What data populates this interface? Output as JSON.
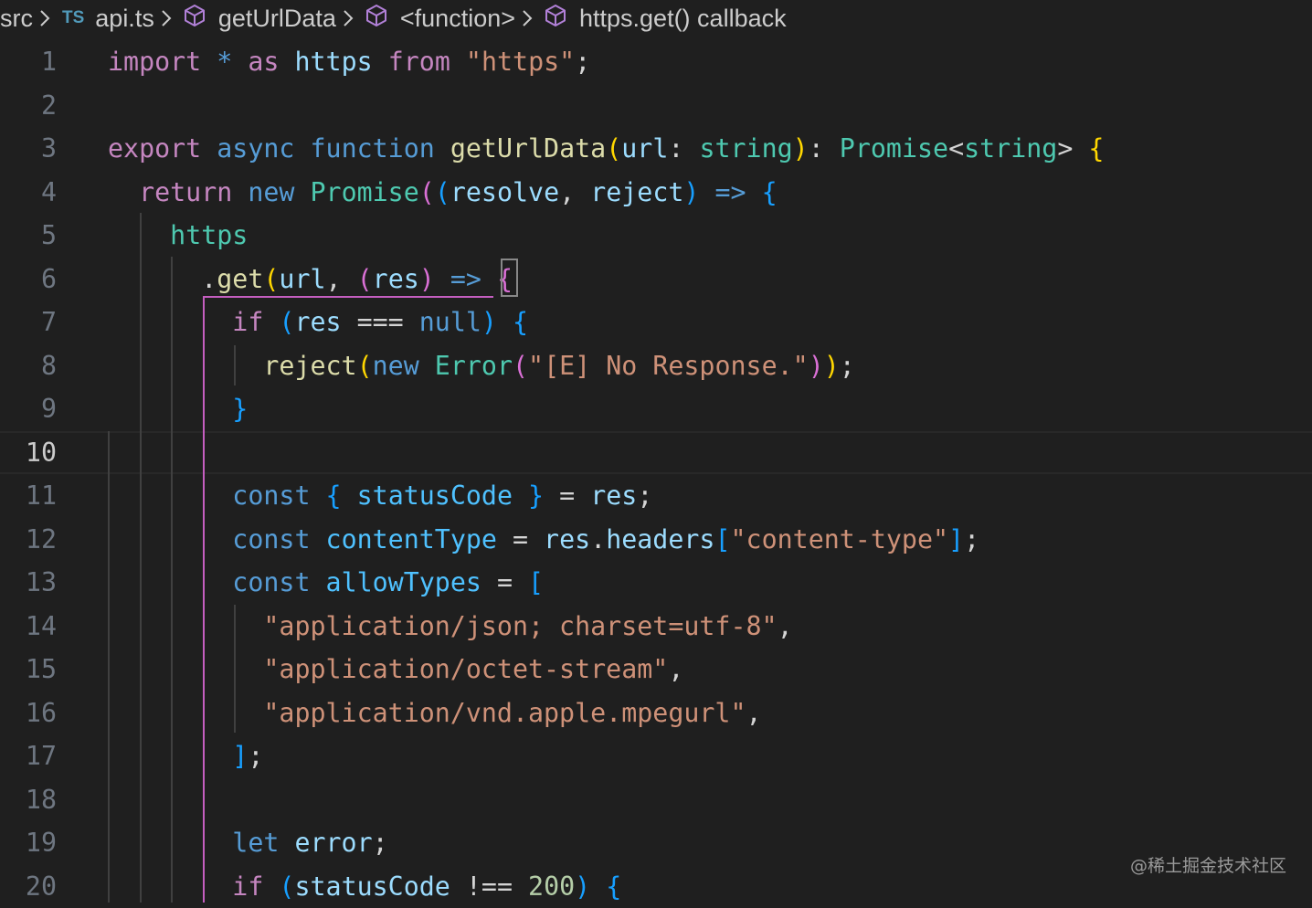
{
  "breadcrumb": {
    "folder": "src",
    "file_badge": "TS",
    "file": "api.ts",
    "symbols": [
      "getUrlData",
      "<function>",
      "https.get() callback"
    ]
  },
  "editor": {
    "language": "typescript",
    "current_line": 10,
    "lines": [
      {
        "n": "1",
        "tokens": [
          [
            "import",
            "kw"
          ],
          [
            " ",
            "pu"
          ],
          [
            "*",
            "kb"
          ],
          [
            " ",
            "pu"
          ],
          [
            "as",
            "kw"
          ],
          [
            " ",
            "pu"
          ],
          [
            "https",
            "va"
          ],
          [
            " ",
            "pu"
          ],
          [
            "from",
            "kw"
          ],
          [
            " ",
            "pu"
          ],
          [
            "\"https\"",
            "st"
          ],
          [
            ";",
            "pu"
          ]
        ]
      },
      {
        "n": "2",
        "tokens": []
      },
      {
        "n": "3",
        "tokens": [
          [
            "export",
            "kw"
          ],
          [
            " ",
            "pu"
          ],
          [
            "async",
            "kb"
          ],
          [
            " ",
            "pu"
          ],
          [
            "function",
            "kb"
          ],
          [
            " ",
            "pu"
          ],
          [
            "getUrlData",
            "fn"
          ],
          [
            "(",
            "b1"
          ],
          [
            "url",
            "va"
          ],
          [
            ": ",
            "pu"
          ],
          [
            "string",
            "ty"
          ],
          [
            ")",
            "b1"
          ],
          [
            ": ",
            "pu"
          ],
          [
            "Promise",
            "ty"
          ],
          [
            "<",
            "pu"
          ],
          [
            "string",
            "ty"
          ],
          [
            "> ",
            "pu"
          ],
          [
            "{",
            "b1"
          ]
        ]
      },
      {
        "n": "4",
        "tokens": [
          [
            "  ",
            "pu"
          ],
          [
            "return",
            "kw"
          ],
          [
            " ",
            "pu"
          ],
          [
            "new",
            "kb"
          ],
          [
            " ",
            "pu"
          ],
          [
            "Promise",
            "ty"
          ],
          [
            "(",
            "b2"
          ],
          [
            "(",
            "b3"
          ],
          [
            "resolve",
            "va"
          ],
          [
            ", ",
            "pu"
          ],
          [
            "reject",
            "va"
          ],
          [
            ")",
            "b3"
          ],
          [
            " ",
            "pu"
          ],
          [
            "=>",
            "kb"
          ],
          [
            " ",
            "pu"
          ],
          [
            "{",
            "b3"
          ]
        ]
      },
      {
        "n": "5",
        "tokens": [
          [
            "    ",
            "pu"
          ],
          [
            "https",
            "ty"
          ]
        ]
      },
      {
        "n": "6",
        "tokens": [
          [
            "      ",
            "pu"
          ],
          [
            ".",
            "pu"
          ],
          [
            "get",
            "fn"
          ],
          [
            "(",
            "b1"
          ],
          [
            "url",
            "va"
          ],
          [
            ", ",
            "pu"
          ],
          [
            "(",
            "b2"
          ],
          [
            "res",
            "va"
          ],
          [
            ")",
            "b2"
          ],
          [
            " ",
            "pu"
          ],
          [
            "=>",
            "kb"
          ],
          [
            " ",
            "pu"
          ],
          [
            "{",
            "b2"
          ]
        ]
      },
      {
        "n": "7",
        "tokens": [
          [
            "        ",
            "pu"
          ],
          [
            "if",
            "kw"
          ],
          [
            " ",
            "pu"
          ],
          [
            "(",
            "b3"
          ],
          [
            "res",
            "va"
          ],
          [
            " === ",
            "pu"
          ],
          [
            "null",
            "kb"
          ],
          [
            ")",
            "b3"
          ],
          [
            " ",
            "pu"
          ],
          [
            "{",
            "b3"
          ]
        ]
      },
      {
        "n": "8",
        "tokens": [
          [
            "          ",
            "pu"
          ],
          [
            "reject",
            "fn"
          ],
          [
            "(",
            "b1"
          ],
          [
            "new",
            "kb"
          ],
          [
            " ",
            "pu"
          ],
          [
            "Error",
            "ty"
          ],
          [
            "(",
            "b2"
          ],
          [
            "\"[E] No Response.\"",
            "st"
          ],
          [
            ")",
            "b2"
          ],
          [
            ")",
            "b1"
          ],
          [
            ";",
            "pu"
          ]
        ]
      },
      {
        "n": "9",
        "tokens": [
          [
            "        ",
            "pu"
          ],
          [
            "}",
            "b3"
          ]
        ]
      },
      {
        "n": "10",
        "tokens": []
      },
      {
        "n": "11",
        "tokens": [
          [
            "        ",
            "pu"
          ],
          [
            "const",
            "kb"
          ],
          [
            " ",
            "pu"
          ],
          [
            "{",
            "b3"
          ],
          [
            " ",
            "pu"
          ],
          [
            "statusCode",
            "cn"
          ],
          [
            " ",
            "pu"
          ],
          [
            "}",
            "b3"
          ],
          [
            " = ",
            "pu"
          ],
          [
            "res",
            "va"
          ],
          [
            ";",
            "pu"
          ]
        ]
      },
      {
        "n": "12",
        "tokens": [
          [
            "        ",
            "pu"
          ],
          [
            "const",
            "kb"
          ],
          [
            " ",
            "pu"
          ],
          [
            "contentType",
            "cn"
          ],
          [
            " = ",
            "pu"
          ],
          [
            "res",
            "va"
          ],
          [
            ".",
            "pu"
          ],
          [
            "headers",
            "va"
          ],
          [
            "[",
            "b3"
          ],
          [
            "\"content-type\"",
            "st"
          ],
          [
            "]",
            "b3"
          ],
          [
            ";",
            "pu"
          ]
        ]
      },
      {
        "n": "13",
        "tokens": [
          [
            "        ",
            "pu"
          ],
          [
            "const",
            "kb"
          ],
          [
            " ",
            "pu"
          ],
          [
            "allowTypes",
            "cn"
          ],
          [
            " = ",
            "pu"
          ],
          [
            "[",
            "b3"
          ]
        ]
      },
      {
        "n": "14",
        "tokens": [
          [
            "          ",
            "pu"
          ],
          [
            "\"application/json; charset=utf-8\"",
            "st"
          ],
          [
            ",",
            "pu"
          ]
        ]
      },
      {
        "n": "15",
        "tokens": [
          [
            "          ",
            "pu"
          ],
          [
            "\"application/octet-stream\"",
            "st"
          ],
          [
            ",",
            "pu"
          ]
        ]
      },
      {
        "n": "16",
        "tokens": [
          [
            "          ",
            "pu"
          ],
          [
            "\"application/vnd.apple.mpegurl\"",
            "st"
          ],
          [
            ",",
            "pu"
          ]
        ]
      },
      {
        "n": "17",
        "tokens": [
          [
            "        ",
            "pu"
          ],
          [
            "]",
            "b3"
          ],
          [
            ";",
            "pu"
          ]
        ]
      },
      {
        "n": "18",
        "tokens": []
      },
      {
        "n": "19",
        "tokens": [
          [
            "        ",
            "pu"
          ],
          [
            "let",
            "kb"
          ],
          [
            " ",
            "pu"
          ],
          [
            "error",
            "va"
          ],
          [
            ";",
            "pu"
          ]
        ]
      },
      {
        "n": "20",
        "tokens": [
          [
            "        ",
            "pu"
          ],
          [
            "if",
            "kw"
          ],
          [
            " ",
            "pu"
          ],
          [
            "(",
            "b3"
          ],
          [
            "statusCode",
            "va"
          ],
          [
            " !== ",
            "pu"
          ],
          [
            "200",
            "nu"
          ],
          [
            ")",
            "b3"
          ],
          [
            " ",
            "pu"
          ],
          [
            "{",
            "b3"
          ]
        ]
      }
    ]
  },
  "watermark": "@稀土掘金技术社区"
}
